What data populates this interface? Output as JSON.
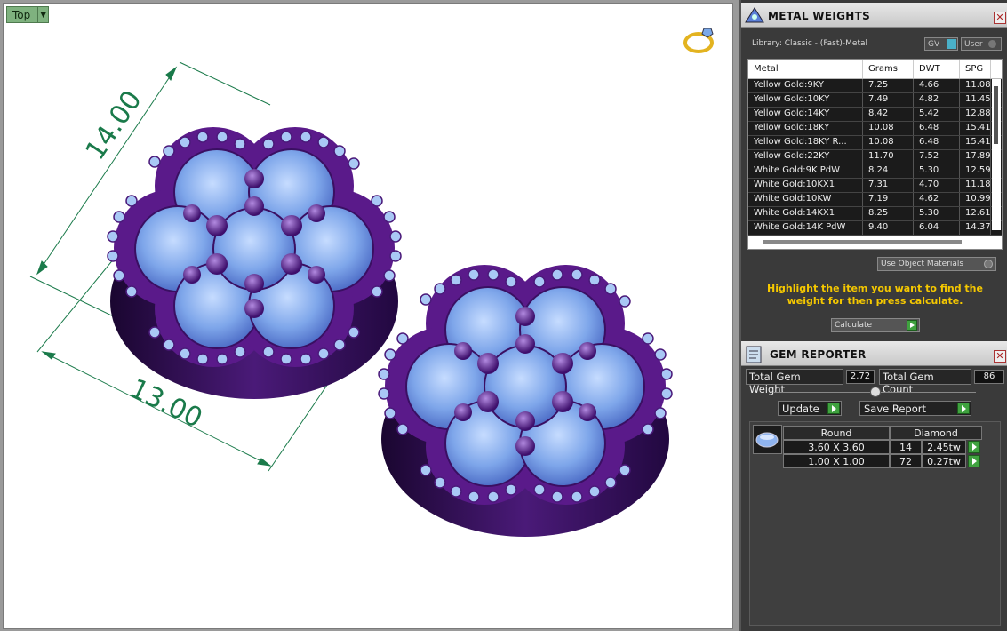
{
  "viewport": {
    "view_label": "Top",
    "dimensions": [
      "14.00",
      "13.00"
    ]
  },
  "metal_panel": {
    "title": "METAL WEIGHTS",
    "library": "Library: Classic - (Fast)-Metal",
    "toggle_gv": "GV",
    "toggle_user": "User",
    "columns": [
      "Metal",
      "Grams",
      "DWT",
      "SPG"
    ],
    "rows": [
      [
        "Yellow Gold:9KY",
        "7.25",
        "4.66",
        "11.08"
      ],
      [
        "Yellow Gold:10KY",
        "7.49",
        "4.82",
        "11.45"
      ],
      [
        "Yellow Gold:14KY",
        "8.42",
        "5.42",
        "12.88"
      ],
      [
        "Yellow Gold:18KY",
        "10.08",
        "6.48",
        "15.41"
      ],
      [
        "Yellow Gold:18KY R...",
        "10.08",
        "6.48",
        "15.41"
      ],
      [
        "Yellow Gold:22KY",
        "11.70",
        "7.52",
        "17.89"
      ],
      [
        "White Gold:9K PdW",
        "8.24",
        "5.30",
        "12.59"
      ],
      [
        "White Gold:10KX1",
        "7.31",
        "4.70",
        "11.18"
      ],
      [
        "White Gold:10KW",
        "7.19",
        "4.62",
        "10.99"
      ],
      [
        "White Gold:14KX1",
        "8.25",
        "5.30",
        "12.61"
      ],
      [
        "White Gold:14K PdW",
        "9.40",
        "6.04",
        "14.37"
      ]
    ],
    "use_object_materials": "Use Object Materials",
    "hint": "Highlight the item you want to find the weight for then press calculate.",
    "calculate": "Calculate"
  },
  "gem_panel": {
    "title": "GEM REPORTER",
    "total_weight_label": "Total Gem Weight",
    "total_weight": "2.72",
    "total_count_label": "Total Gem Count",
    "total_count": "86",
    "update": "Update",
    "save_report": "Save Report",
    "shape": "Round",
    "material": "Diamond",
    "gems": [
      {
        "size": "3.60 X 3.60",
        "count": "14",
        "weight": "2.45tw"
      },
      {
        "size": "1.00 X 1.00",
        "count": "72",
        "weight": "0.27tw"
      }
    ]
  },
  "colors": {
    "accent_hint": "#f5c800",
    "go_button": "#3fa23f",
    "metal": "#5a1a8a",
    "stone": "#8fb4ef"
  }
}
